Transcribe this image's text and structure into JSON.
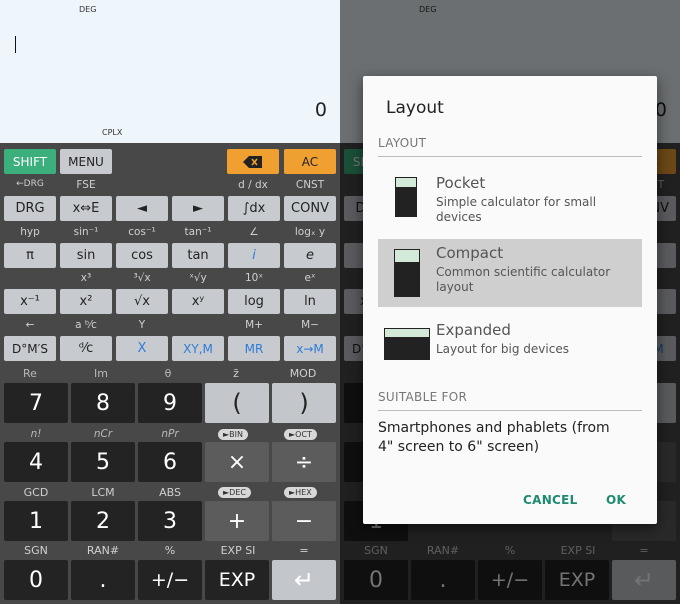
{
  "display": {
    "mode": "DEG",
    "value": "0",
    "cplx": "CPLX"
  },
  "row1": {
    "shift": "SHIFT",
    "menu": "MENU",
    "ac": "AC"
  },
  "labels1": {
    "drg_back": "←DRG",
    "fse": "FSE",
    "d_dx": "d / dx",
    "cnst": "CNST"
  },
  "row2": {
    "drg": "DRG",
    "xe": "x⇔E",
    "left": "◄",
    "right": "►",
    "int_dx": "∫dx",
    "conv": "CONV"
  },
  "labels2": {
    "hyp": "hyp",
    "asin": "sin⁻¹",
    "acos": "cos⁻¹",
    "atan": "tan⁻¹",
    "angle": "∠",
    "logxy": "logₓ y"
  },
  "row3": {
    "pi": "π",
    "sin": "sin",
    "cos": "cos",
    "tan": "tan",
    "i": "i",
    "e": "e"
  },
  "labels3": {
    "x3": "x³",
    "cbrt": "³√x",
    "xrt": "ˣ√y",
    "tenx": "10ˣ",
    "ex": "eˣ"
  },
  "row4": {
    "inv": "x⁻¹",
    "sq": "x²",
    "sqrt": "√x",
    "pow": "xʸ",
    "log": "log",
    "ln": "ln"
  },
  "labels4": {
    "larrow": "←",
    "abc": "a ᵇ⁄c",
    "y": "Y",
    "mplus": "M+",
    "mminus": "M−"
  },
  "row5": {
    "dms": "D°M′S",
    "dc": "ᵈ⁄c",
    "x": "X",
    "xym": "XY,M",
    "mr": "MR",
    "xm": "x→M"
  },
  "labels5": {
    "re": "Re",
    "im": "Im",
    "theta": "θ",
    "zbar": "z̄",
    "mod": "MOD"
  },
  "row6": {
    "k7": "7",
    "k8": "8",
    "k9": "9",
    "lp": "(",
    "rp": ")"
  },
  "labels6": {
    "nfact": "n!",
    "ncr": "nCr",
    "npr": "nPr",
    "bin": "►BIN",
    "oct": "►OCT"
  },
  "row7": {
    "k4": "4",
    "k5": "5",
    "k6": "6",
    "mul": "×",
    "div": "÷"
  },
  "labels7": {
    "gcd": "GCD",
    "lcm": "LCM",
    "abs": "ABS",
    "dec": "►DEC",
    "hex": "►HEX"
  },
  "row8": {
    "k1": "1",
    "k2": "2",
    "k3": "3",
    "plus": "+",
    "minus": "−"
  },
  "labels8": {
    "sgn": "SGN",
    "ran": "RAN#",
    "pct": "%",
    "expsi": "EXP SI",
    "eq": "="
  },
  "row9": {
    "k0": "0",
    "dot": ".",
    "neg": "+/−",
    "exp": "EXP",
    "enter": "↵"
  },
  "dialog": {
    "title": "Layout",
    "section_layout": "LAYOUT",
    "options": [
      {
        "name": "Pocket",
        "desc": "Simple calculator for small devices"
      },
      {
        "name": "Compact",
        "desc": "Common scientific calculator layout"
      },
      {
        "name": "Expanded",
        "desc": "Layout for big devices"
      }
    ],
    "section_suitable": "SUITABLE FOR",
    "suitable_text": "Smartphones and phablets (from 4\" screen to 6\" screen)",
    "cancel": "CANCEL",
    "ok": "OK"
  },
  "colors": {
    "shift": "#3bb07c",
    "orange": "#f0a030",
    "blue_text": "#2f7bd6",
    "accent_button": "#1f8a72"
  }
}
